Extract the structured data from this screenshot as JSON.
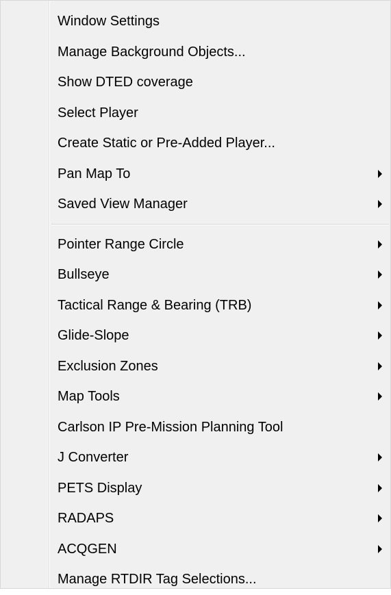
{
  "menu": {
    "group1": [
      {
        "label": "Window Settings",
        "submenu": false
      },
      {
        "label": "Manage Background Objects...",
        "submenu": false
      },
      {
        "label": "Show DTED coverage",
        "submenu": false
      },
      {
        "label": "Select Player",
        "submenu": false
      },
      {
        "label": "Create Static or Pre-Added Player...",
        "submenu": false
      },
      {
        "label": "Pan Map To",
        "submenu": true
      },
      {
        "label": "Saved View Manager",
        "submenu": true
      }
    ],
    "group2": [
      {
        "label": "Pointer Range Circle",
        "submenu": true
      },
      {
        "label": "Bullseye",
        "submenu": true
      },
      {
        "label": "Tactical Range & Bearing (TRB)",
        "submenu": true
      },
      {
        "label": "Glide-Slope",
        "submenu": true
      },
      {
        "label": "Exclusion Zones",
        "submenu": true
      },
      {
        "label": "Map Tools",
        "submenu": true
      },
      {
        "label": "Carlson IP Pre-Mission Planning Tool",
        "submenu": false
      },
      {
        "label": "J Converter",
        "submenu": true
      },
      {
        "label": "PETS Display",
        "submenu": true
      },
      {
        "label": "RADAPS",
        "submenu": true
      },
      {
        "label": "ACQGEN",
        "submenu": true
      },
      {
        "label": "Manage RTDIR Tag Selections...",
        "submenu": false
      }
    ],
    "submenu_icon": "chevron-right-icon",
    "colors": {
      "background": "#f0f0f0",
      "text": "#000000",
      "separator": "#d7d7d7"
    }
  }
}
